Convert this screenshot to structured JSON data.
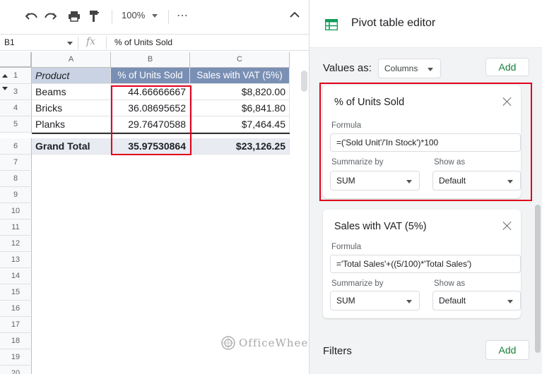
{
  "toolbar": {
    "zoom": "100%",
    "more": "⋯"
  },
  "formula_bar": {
    "cell_ref": "B1",
    "fx": "fx",
    "content": "% of Units Sold"
  },
  "sheet": {
    "columns": [
      "A",
      "B",
      "C"
    ],
    "row_numbers": [
      "1",
      "3",
      "4",
      "5",
      "6",
      "7",
      "8",
      "9",
      "10",
      "11",
      "12",
      "13",
      "14",
      "15",
      "16",
      "17",
      "18",
      "19",
      "20"
    ],
    "header": {
      "a": "Product",
      "b": "% of Units Sold",
      "c": "Sales with VAT (5%)"
    },
    "rows": [
      {
        "a": "Beams",
        "b": "44.66666667",
        "c": "$8,820.00"
      },
      {
        "a": "Bricks",
        "b": "36.08695652",
        "c": "$6,841.80"
      },
      {
        "a": "Planks",
        "b": "29.76470588",
        "c": "$7,464.45"
      }
    ],
    "total": {
      "a": "Grand Total",
      "b": "35.97530864",
      "c": "$23,126.25"
    }
  },
  "watermark": "OfficeWheel",
  "editor": {
    "title": "Pivot table editor",
    "values_label": "Values as:",
    "values_as": "Columns",
    "add_label": "Add",
    "cards": [
      {
        "title": "% of Units Sold",
        "formula_label": "Formula",
        "formula": "=('Sold Unit'/'In Stock')*100",
        "summarize_label": "Summarize by",
        "summarize": "SUM",
        "showas_label": "Show as",
        "showas": "Default"
      },
      {
        "title": "Sales with VAT (5%)",
        "formula_label": "Formula",
        "formula": "='Total Sales'+((5/100)*'Total Sales')",
        "summarize_label": "Summarize by",
        "summarize": "SUM",
        "showas_label": "Show as",
        "showas": "Default"
      }
    ],
    "filters_label": "Filters",
    "filters_add": "Add"
  },
  "colors": {
    "highlight_red": "#e0001b",
    "pivot_header_blue": "#7a8fb4",
    "add_green": "#188038",
    "sheets_green": "#0f9d58"
  }
}
